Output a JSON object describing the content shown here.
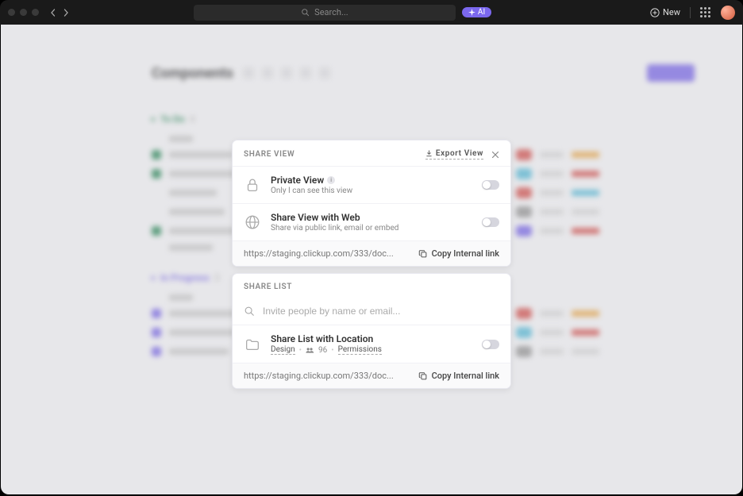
{
  "header": {
    "search_placeholder": "Search...",
    "ai_label": "AI",
    "new_label": "New"
  },
  "backdrop": {
    "page_title": "Components",
    "section1": "To Do",
    "section2": "In Progress",
    "count1": "4",
    "count2": "3"
  },
  "share_view": {
    "title": "SHARE VIEW",
    "export_label": "Export View",
    "private_title": "Private View",
    "private_sub": "Only I can see this view",
    "web_title": "Share View with Web",
    "web_sub": "Share via public link, email or embed",
    "url": "https://staging.clickup.com/333/doc...",
    "copy_label": "Copy Internal link"
  },
  "share_list": {
    "title": "SHARE LIST",
    "invite_placeholder": "Invite people by name or email...",
    "location_title": "Share List with Location",
    "design_label": "Design",
    "people_count": "96",
    "permissions_label": "Permissions",
    "url": "https://staging.clickup.com/333/doc...",
    "copy_label": "Copy Internal link"
  }
}
